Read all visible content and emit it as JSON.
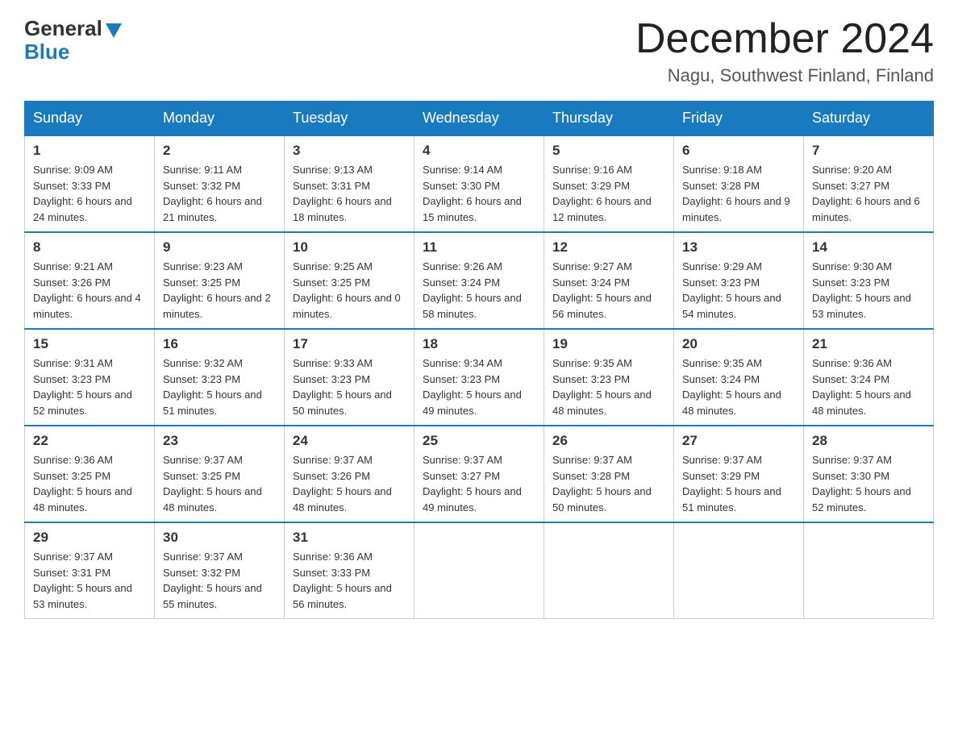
{
  "header": {
    "logo_general": "General",
    "logo_blue": "Blue",
    "month_title": "December 2024",
    "location": "Nagu, Southwest Finland, Finland"
  },
  "weekdays": [
    "Sunday",
    "Monday",
    "Tuesday",
    "Wednesday",
    "Thursday",
    "Friday",
    "Saturday"
  ],
  "weeks": [
    [
      {
        "day": "1",
        "sunrise": "9:09 AM",
        "sunset": "3:33 PM",
        "daylight": "6 hours and 24 minutes."
      },
      {
        "day": "2",
        "sunrise": "9:11 AM",
        "sunset": "3:32 PM",
        "daylight": "6 hours and 21 minutes."
      },
      {
        "day": "3",
        "sunrise": "9:13 AM",
        "sunset": "3:31 PM",
        "daylight": "6 hours and 18 minutes."
      },
      {
        "day": "4",
        "sunrise": "9:14 AM",
        "sunset": "3:30 PM",
        "daylight": "6 hours and 15 minutes."
      },
      {
        "day": "5",
        "sunrise": "9:16 AM",
        "sunset": "3:29 PM",
        "daylight": "6 hours and 12 minutes."
      },
      {
        "day": "6",
        "sunrise": "9:18 AM",
        "sunset": "3:28 PM",
        "daylight": "6 hours and 9 minutes."
      },
      {
        "day": "7",
        "sunrise": "9:20 AM",
        "sunset": "3:27 PM",
        "daylight": "6 hours and 6 minutes."
      }
    ],
    [
      {
        "day": "8",
        "sunrise": "9:21 AM",
        "sunset": "3:26 PM",
        "daylight": "6 hours and 4 minutes."
      },
      {
        "day": "9",
        "sunrise": "9:23 AM",
        "sunset": "3:25 PM",
        "daylight": "6 hours and 2 minutes."
      },
      {
        "day": "10",
        "sunrise": "9:25 AM",
        "sunset": "3:25 PM",
        "daylight": "6 hours and 0 minutes."
      },
      {
        "day": "11",
        "sunrise": "9:26 AM",
        "sunset": "3:24 PM",
        "daylight": "5 hours and 58 minutes."
      },
      {
        "day": "12",
        "sunrise": "9:27 AM",
        "sunset": "3:24 PM",
        "daylight": "5 hours and 56 minutes."
      },
      {
        "day": "13",
        "sunrise": "9:29 AM",
        "sunset": "3:23 PM",
        "daylight": "5 hours and 54 minutes."
      },
      {
        "day": "14",
        "sunrise": "9:30 AM",
        "sunset": "3:23 PM",
        "daylight": "5 hours and 53 minutes."
      }
    ],
    [
      {
        "day": "15",
        "sunrise": "9:31 AM",
        "sunset": "3:23 PM",
        "daylight": "5 hours and 52 minutes."
      },
      {
        "day": "16",
        "sunrise": "9:32 AM",
        "sunset": "3:23 PM",
        "daylight": "5 hours and 51 minutes."
      },
      {
        "day": "17",
        "sunrise": "9:33 AM",
        "sunset": "3:23 PM",
        "daylight": "5 hours and 50 minutes."
      },
      {
        "day": "18",
        "sunrise": "9:34 AM",
        "sunset": "3:23 PM",
        "daylight": "5 hours and 49 minutes."
      },
      {
        "day": "19",
        "sunrise": "9:35 AM",
        "sunset": "3:23 PM",
        "daylight": "5 hours and 48 minutes."
      },
      {
        "day": "20",
        "sunrise": "9:35 AM",
        "sunset": "3:24 PM",
        "daylight": "5 hours and 48 minutes."
      },
      {
        "day": "21",
        "sunrise": "9:36 AM",
        "sunset": "3:24 PM",
        "daylight": "5 hours and 48 minutes."
      }
    ],
    [
      {
        "day": "22",
        "sunrise": "9:36 AM",
        "sunset": "3:25 PM",
        "daylight": "5 hours and 48 minutes."
      },
      {
        "day": "23",
        "sunrise": "9:37 AM",
        "sunset": "3:25 PM",
        "daylight": "5 hours and 48 minutes."
      },
      {
        "day": "24",
        "sunrise": "9:37 AM",
        "sunset": "3:26 PM",
        "daylight": "5 hours and 48 minutes."
      },
      {
        "day": "25",
        "sunrise": "9:37 AM",
        "sunset": "3:27 PM",
        "daylight": "5 hours and 49 minutes."
      },
      {
        "day": "26",
        "sunrise": "9:37 AM",
        "sunset": "3:28 PM",
        "daylight": "5 hours and 50 minutes."
      },
      {
        "day": "27",
        "sunrise": "9:37 AM",
        "sunset": "3:29 PM",
        "daylight": "5 hours and 51 minutes."
      },
      {
        "day": "28",
        "sunrise": "9:37 AM",
        "sunset": "3:30 PM",
        "daylight": "5 hours and 52 minutes."
      }
    ],
    [
      {
        "day": "29",
        "sunrise": "9:37 AM",
        "sunset": "3:31 PM",
        "daylight": "5 hours and 53 minutes."
      },
      {
        "day": "30",
        "sunrise": "9:37 AM",
        "sunset": "3:32 PM",
        "daylight": "5 hours and 55 minutes."
      },
      {
        "day": "31",
        "sunrise": "9:36 AM",
        "sunset": "3:33 PM",
        "daylight": "5 hours and 56 minutes."
      },
      null,
      null,
      null,
      null
    ]
  ],
  "labels": {
    "sunrise": "Sunrise:",
    "sunset": "Sunset:",
    "daylight": "Daylight:"
  }
}
